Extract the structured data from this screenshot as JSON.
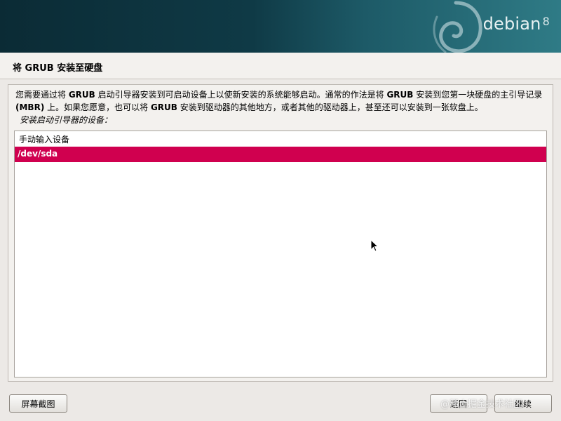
{
  "banner": {
    "brand": "debian",
    "version": "8",
    "logo_icon": "debian-swirl-icon"
  },
  "title": "将 GRUB 安装至硬盘",
  "description": {
    "line1_part1": "您需要通过将 ",
    "line1_bold1": "GRUB",
    "line1_part2": " 启动引导器安装到可启动设备上以使新安装的系统能够启动。通常的作法是将 ",
    "line1_bold2": "GRUB",
    "line1_part3": " 安装到您第一块硬盘的主引导记录",
    "line2_bold": "(MBR)",
    "line2_part1": " 上。如果您愿意，也可以将 ",
    "line2_bold2": "GRUB",
    "line2_part2": " 安装到驱动器的其他地方，或者其他的驱动器上，甚至还可以安装到一张软盘上。"
  },
  "list": {
    "label": "安装启动引导器的设备：",
    "items": [
      {
        "label": "手动输入设备",
        "selected": false
      },
      {
        "label": "/dev/sda",
        "selected": true
      }
    ]
  },
  "buttons": {
    "screenshot": "屏幕截图",
    "back": "返回",
    "continue": "继续"
  },
  "watermark": "@稀土掘金技术社区",
  "colors": {
    "selection": "#d0004f",
    "banner_dark": "#0b2b35",
    "banner_light": "#2f7b86"
  }
}
